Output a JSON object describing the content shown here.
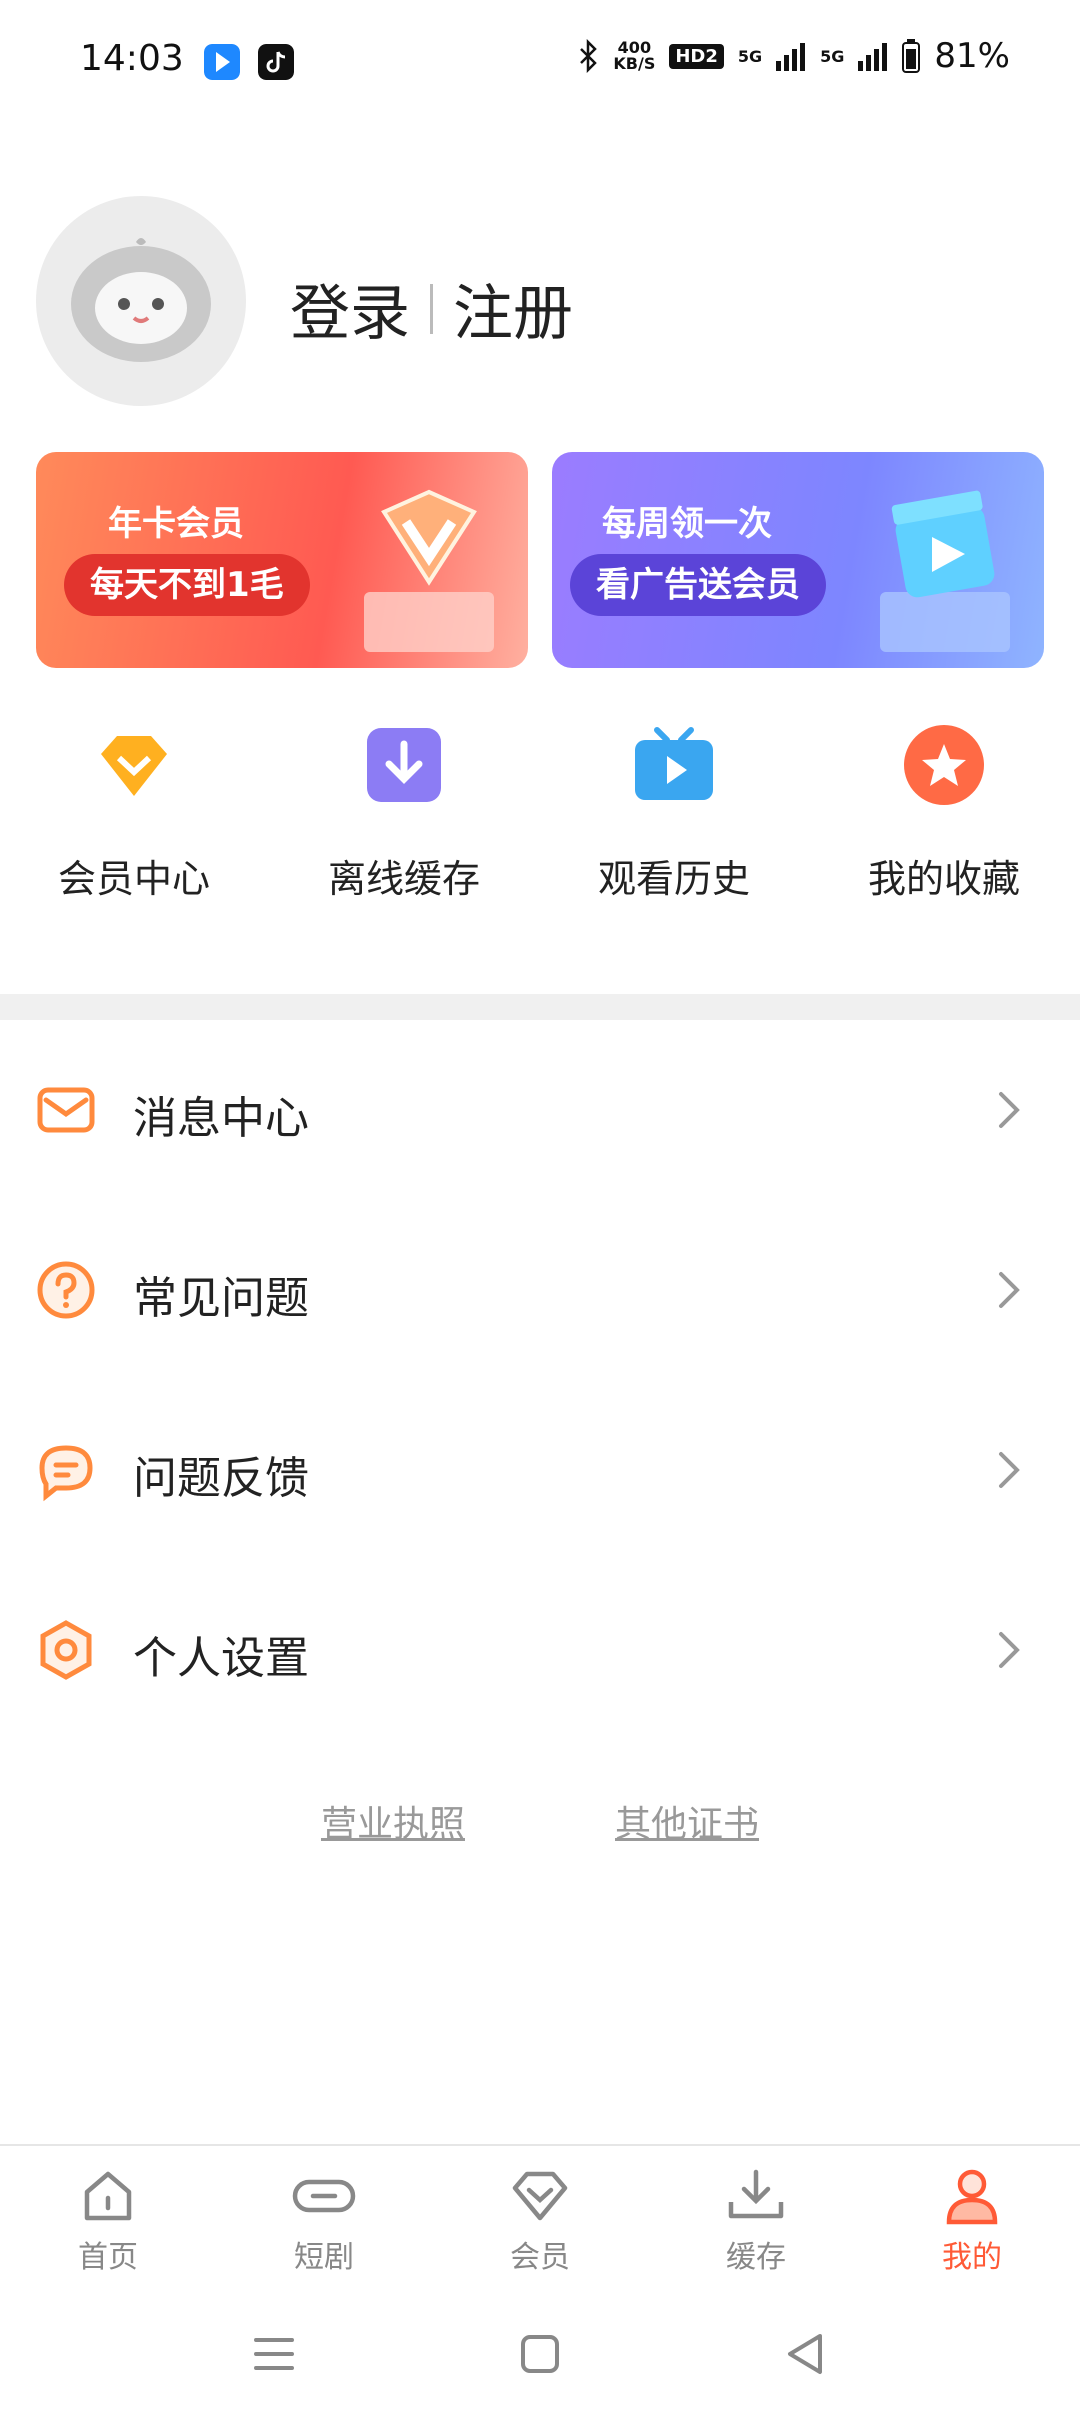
{
  "status_bar": {
    "time": "14:03",
    "speed_value": "400",
    "speed_unit": "KB/S",
    "hd_badge": "HD2",
    "network_1": "5G",
    "network_2": "5G",
    "battery": "81%"
  },
  "profile": {
    "login": "登录",
    "register": "注册"
  },
  "banners": {
    "left": {
      "line1": "年卡会员",
      "line2": "每天不到1毛"
    },
    "right": {
      "line1": "每周领一次",
      "line2": "看广告送会员"
    }
  },
  "quick_actions": [
    {
      "label": "会员中心",
      "icon": "vip-diamond-icon"
    },
    {
      "label": "离线缓存",
      "icon": "download-icon"
    },
    {
      "label": "观看历史",
      "icon": "tv-play-icon"
    },
    {
      "label": "我的收藏",
      "icon": "star-icon"
    }
  ],
  "menu": [
    {
      "label": "消息中心",
      "icon": "mail-icon"
    },
    {
      "label": "常见问题",
      "icon": "question-icon"
    },
    {
      "label": "问题反馈",
      "icon": "feedback-icon"
    },
    {
      "label": "个人设置",
      "icon": "settings-hex-icon"
    }
  ],
  "footer": {
    "business_license": "营业执照",
    "other_certificates": "其他证书"
  },
  "tabbar": [
    {
      "label": "首页",
      "icon": "home-icon"
    },
    {
      "label": "短剧",
      "icon": "link-icon"
    },
    {
      "label": "会员",
      "icon": "vip-icon"
    },
    {
      "label": "缓存",
      "icon": "download-tray-icon"
    },
    {
      "label": "我的",
      "icon": "person-icon",
      "active": true
    }
  ],
  "colors": {
    "accent": "#ff5a36",
    "menu_icon": "#ff8a3d",
    "tab_inactive": "#888888"
  }
}
